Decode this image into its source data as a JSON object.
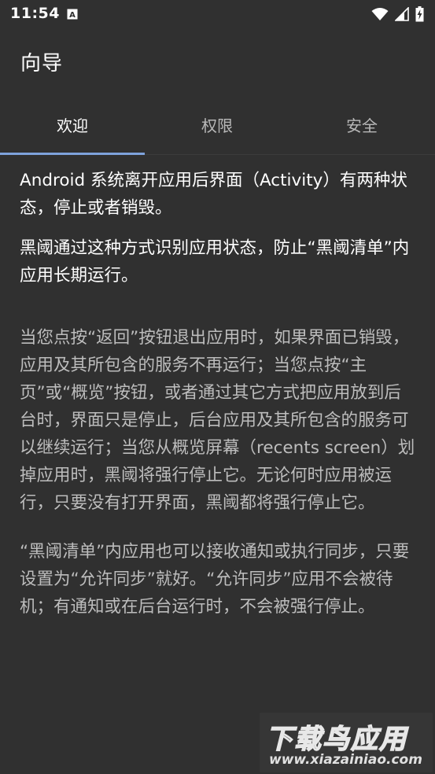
{
  "status_bar": {
    "time": "11:54",
    "icons": [
      "notification-a-icon",
      "wifi-icon",
      "signal-icon",
      "battery-charging-icon"
    ]
  },
  "app_bar": {
    "title": "向导"
  },
  "tabs": [
    {
      "label": "欢迎",
      "selected": true
    },
    {
      "label": "权限",
      "selected": false
    },
    {
      "label": "安全",
      "selected": false
    }
  ],
  "content": {
    "paragraphs": [
      "Android 系统离开应用后界面（Activity）有两种状态，停止或者销毁。",
      "黑阈通过这种方式识别应用状态，防止“黑阈清单”内应用长期运行。",
      "当您点按“返回”按钮退出应用时，如果界面已销毁，应用及其所包含的服务不再运行；当您点按“主页”或“概览”按钮，或者通过其它方式把应用放到后台时，界面只是停止，后台应用及其所包含的服务可以继续运行；当您从概览屏幕（recents screen）划掉应用时，黑阈将强行停止它。无论何时应用被运行，只要没有打开界面，黑阈都将强行停止它。",
      "“黑阈清单”内应用也可以接收通知或执行同步，只要设置为“允许同步”就好。“允许同步”应用不会被待机；有通知或在后台运行时，不会被强行停止。"
    ]
  },
  "watermark": {
    "title": "下载鸟应用",
    "url": "www.xiazainiao.com"
  },
  "colors": {
    "background": "#303030",
    "tab_indicator": "#7ea3dc",
    "primary_text": "#ffffff",
    "secondary_text": "#bdbdbd"
  }
}
